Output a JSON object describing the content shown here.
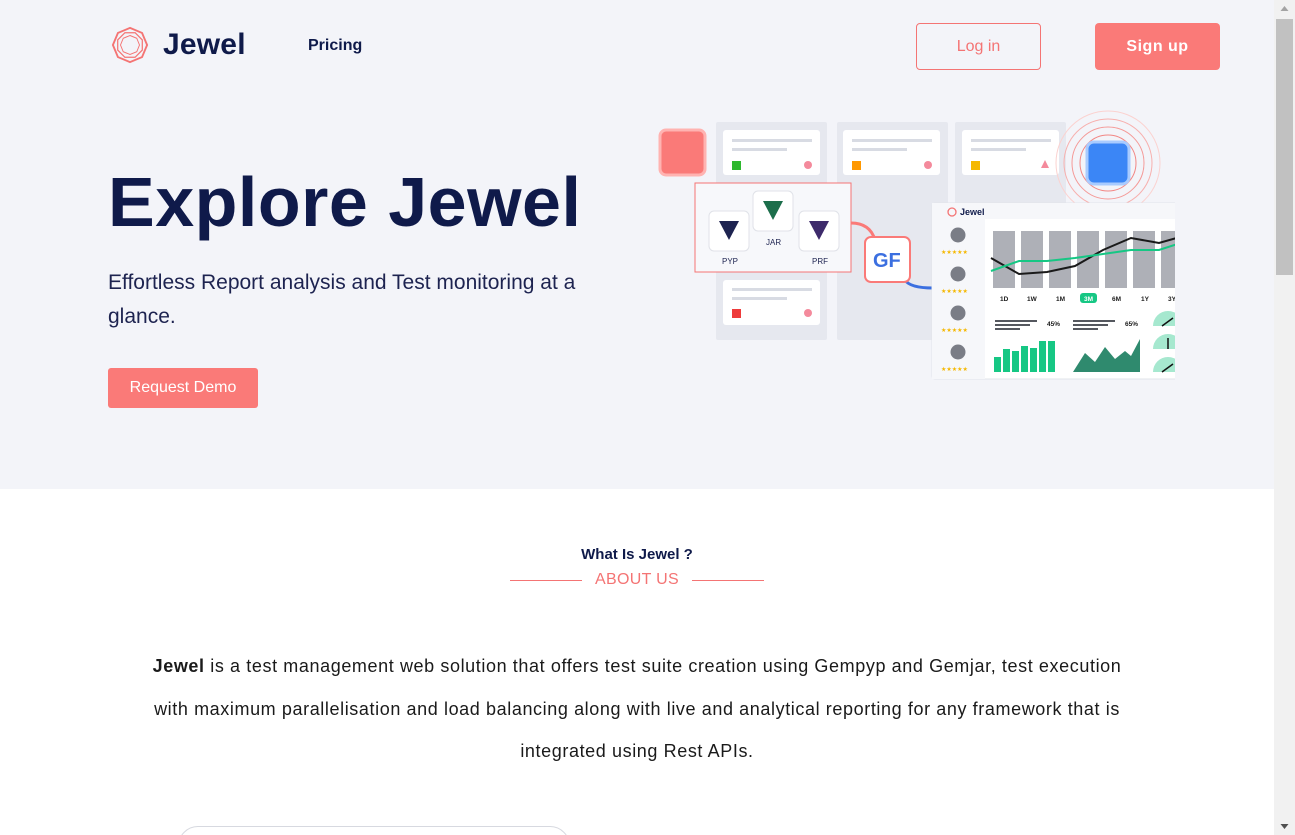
{
  "header": {
    "brand": "Jewel",
    "nav_pricing": "Pricing",
    "login_label": "Log in",
    "signup_label": "Sign up"
  },
  "hero": {
    "title": "Explore Jewel",
    "subtitle": "Effortless Report analysis and Test monitoring at a glance.",
    "cta_label": "Request Demo"
  },
  "illustration": {
    "dashboard_brand": "Jewel",
    "framework_labels": [
      "PYP",
      "JAR",
      "PRF"
    ],
    "time_ranges": [
      "1D",
      "1W",
      "1M",
      "3M",
      "6M",
      "1Y",
      "3Y"
    ],
    "selected_range": "3M",
    "percent_values": [
      "45%",
      "65%"
    ]
  },
  "about": {
    "heading": "What Is Jewel ?",
    "tag": "ABOUT US",
    "brand": "Jewel",
    "description": " is a test management web solution that offers test suite creation using Gempyp and Gemjar, test execution with maximum parallelisation and load balancing along with live and analytical reporting for any framework that is integrated using Rest APIs."
  },
  "colors": {
    "primary": "#fa7a78",
    "navy": "#0f1a4a",
    "hero_bg": "#f3f4f9",
    "accent_green": "#16c784",
    "accent_blue": "#3b82f6"
  }
}
